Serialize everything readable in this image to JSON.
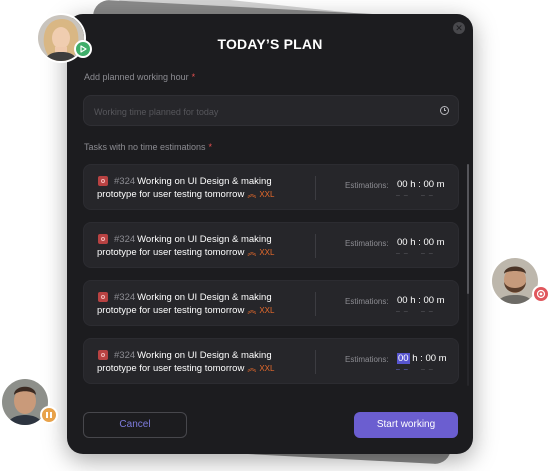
{
  "dialog": {
    "title": "TODAY’S PLAN",
    "close_icon": "close-icon"
  },
  "hours_field": {
    "label": "Add planned working hour",
    "required_mark": "*",
    "placeholder": "Working time planned for today",
    "value": "",
    "icon": "clock-icon"
  },
  "tasks_section": {
    "label": "Tasks with no time estimations",
    "required_mark": "*"
  },
  "tasks": [
    {
      "id": "#324",
      "title_line1": "Working on UI Design & making",
      "title_line2": "prototype for user testing tomorrow",
      "priority_icon": "double-chevron-up-icon",
      "size": "XXL",
      "est_label": "Estimations:",
      "hh": "00",
      "h_unit": "h",
      "sep": ":",
      "mm": "00",
      "m_unit": "m",
      "dash_hh": "– –",
      "dash_mm": "– –",
      "hh_active": false
    },
    {
      "id": "#324",
      "title_line1": "Working on UI Design & making",
      "title_line2": "prototype for user testing tomorrow",
      "priority_icon": "double-chevron-up-icon",
      "size": "XXL",
      "est_label": "Estimations:",
      "hh": "00",
      "h_unit": "h",
      "sep": ":",
      "mm": "00",
      "m_unit": "m",
      "dash_hh": "– –",
      "dash_mm": "– –",
      "hh_active": false
    },
    {
      "id": "#324",
      "title_line1": "Working on UI Design & making",
      "title_line2": "prototype for user testing tomorrow",
      "priority_icon": "double-chevron-up-icon",
      "size": "XXL",
      "est_label": "Estimations:",
      "hh": "00",
      "h_unit": "h",
      "sep": ":",
      "mm": "00",
      "m_unit": "m",
      "dash_hh": "– –",
      "dash_mm": "– –",
      "hh_active": false
    },
    {
      "id": "#324",
      "title_line1": "Working on UI Design & making",
      "title_line2": "prototype for user testing tomorrow",
      "priority_icon": "double-chevron-up-icon",
      "size": "XXL",
      "est_label": "Estimations:",
      "hh": "00",
      "h_unit": "h",
      "sep": ":",
      "mm": "00",
      "m_unit": "m",
      "dash_hh": "– –",
      "dash_mm": "– –",
      "hh_active": true
    }
  ],
  "actions": {
    "cancel_label": "Cancel",
    "start_label": "Start working"
  },
  "avatars": [
    {
      "name": "avatar-woman",
      "badge_icon": "play-icon",
      "badge_color": "#3fae6a"
    },
    {
      "name": "avatar-bearded-man",
      "badge_icon": "record-icon",
      "badge_color": "#e0575d"
    },
    {
      "name": "avatar-man",
      "badge_icon": "pause-icon",
      "badge_color": "#e8a24a"
    }
  ],
  "colors": {
    "accent": "#6b5ed0",
    "background": "#1c1c1f",
    "priority": "#e66a2c"
  }
}
